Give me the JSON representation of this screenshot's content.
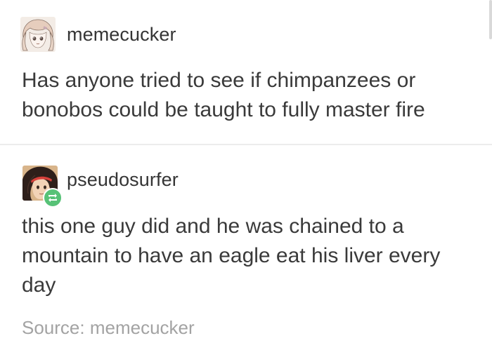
{
  "posts": [
    {
      "username": "memecucker",
      "text": "Has anyone tried to see if chimpanzees or bonobos could be taught to fully master fire",
      "avatar_icon": "anime-avatar-icon"
    },
    {
      "username": "pseudosurfer",
      "text": "this one guy did and he was chained to a mountain to have an eagle eat his liver every day",
      "avatar_icon": "anime-avatar-icon",
      "badge_icon": "reblog-icon",
      "source_label": "Source: memecucker"
    }
  ],
  "colors": {
    "text": "#3a3a3a",
    "username": "#353535",
    "source": "#a3a3a3",
    "reblog_badge": "#57c277",
    "divider": "#ececec"
  }
}
